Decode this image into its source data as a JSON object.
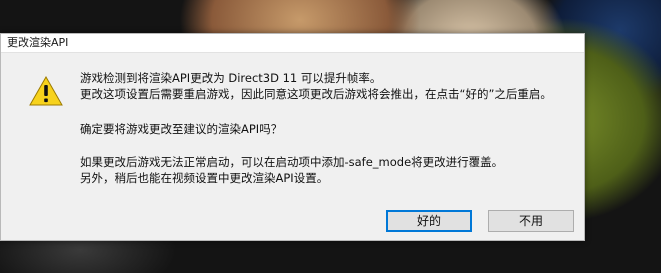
{
  "window": {
    "title": "更改渲染API"
  },
  "message": {
    "line1": "游戏检测到将渲染API更改为 Direct3D 11 可以提升帧率。",
    "line2": "更改这项设置后需要重启游戏，因此同意这项更改后游戏将会推出，在点击“好的”之后重启。",
    "line3": "确定要将游戏更改至建议的渲染API吗？",
    "line4": "如果更改后游戏无法正常启动，可以在启动项中添加-safe_mode将更改进行覆盖。",
    "line5": "另外，稍后也能在视频设置中更改渲染API设置。"
  },
  "buttons": {
    "ok_label": "好的",
    "cancel_label": "不用"
  },
  "icons": {
    "dialog_icon": "warning-icon"
  },
  "colors": {
    "warning_yellow": "#f7d21c",
    "focus_border": "#0078d7"
  }
}
